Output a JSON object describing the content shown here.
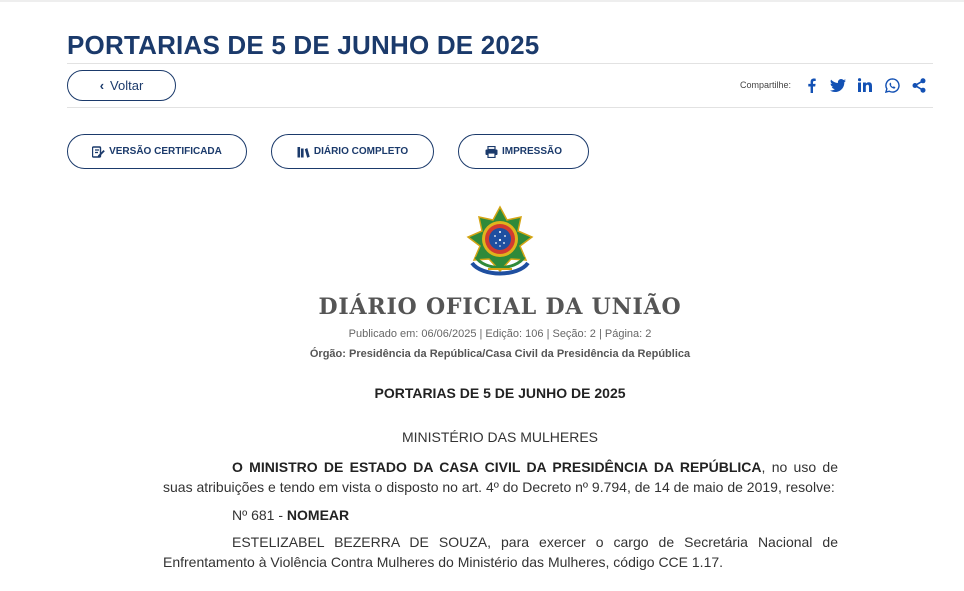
{
  "page": {
    "title": "PORTARIAS DE 5 DE JUNHO DE 2025"
  },
  "toolbar": {
    "back_label": "Voltar",
    "share_label": "Compartilhe:",
    "share_icons": [
      "facebook-icon",
      "twitter-icon",
      "linkedin-icon",
      "whatsapp-icon",
      "share-icon"
    ]
  },
  "actions": {
    "certified_label": "VERSÃO CERTIFICADA",
    "full_diary_label": "DIÁRIO COMPLETO",
    "print_label": "IMPRESSÃO"
  },
  "document": {
    "masthead": "DIÁRIO OFICIAL DA UNIÃO",
    "publication_info": "Publicado em: 06/06/2025 | Edição: 106 | Seção: 2 | Página: 2",
    "orgao_label": "Órgão:",
    "orgao_value": "Presidência da República/Casa Civil da Presidência da República",
    "heading": "PORTARIAS DE 5 DE JUNHO DE 2025",
    "ministry": "MINISTÉRIO DAS MULHERES",
    "authority": "O MINISTRO DE ESTADO DA CASA CIVIL DA PRESIDÊNCIA DA REPÚBLICA",
    "preamble": ", no uso de suas atribuições e tendo em vista o disposto no art. 4º do Decreto nº 9.794, de 14 de maio de 2019, resolve:",
    "act_number": "Nº 681 - ",
    "act_verb": "NOMEAR",
    "act_text": "ESTELIZABEL BEZERRA DE SOUZA, para exercer o cargo de Secretária Nacional de Enfrentamento à Violência Contra Mulheres do Ministério das Mulheres, código CCE 1.17."
  },
  "colors": {
    "primary": "#1b3a6b",
    "share_icon": "#1351b4",
    "text": "#333333"
  }
}
